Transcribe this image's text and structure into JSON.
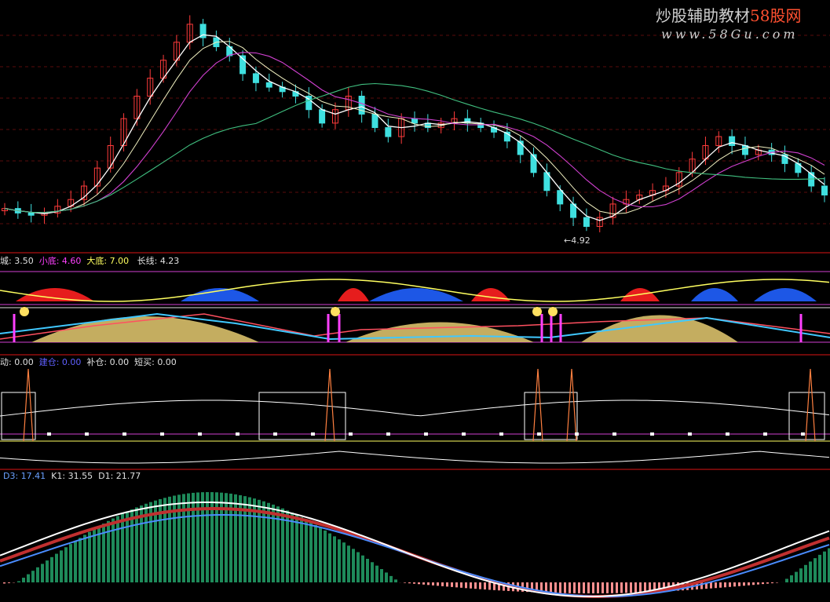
{
  "watermark": {
    "line1_a": "炒股辅助教材",
    "line1_b": "58股网",
    "line2": "www.58Gu.com"
  },
  "price_panel": {
    "low_annotation": "←4.92"
  },
  "indicator1": {
    "labels": [
      {
        "key": "城",
        "value": "3.50",
        "color": "#e0e0e0"
      },
      {
        "key": "小底",
        "value": "4.60",
        "color": "#ff40ff"
      },
      {
        "key": "大底",
        "value": "7.00",
        "color": "#ffff60"
      },
      {
        "key": "长线",
        "value": "4.23",
        "color": "#e0e0e0"
      }
    ]
  },
  "indicator2": {
    "labels": [
      {
        "key": "动",
        "value": "0.00",
        "color": "#e0e0e0"
      },
      {
        "key": "建仓",
        "value": "0.00",
        "color": "#6060ff"
      },
      {
        "key": "补仓",
        "value": "0.00",
        "color": "#e0e0e0"
      },
      {
        "key": "短买",
        "value": "0.00",
        "color": "#e0e0e0"
      }
    ]
  },
  "indicator3": {
    "labels": [
      {
        "key": "D3",
        "value": "17.41",
        "color": "#6aa0ff"
      },
      {
        "key": "K1",
        "value": "31.55",
        "color": "#e0e0e0"
      },
      {
        "key": "D1",
        "value": "21.77",
        "color": "#e0e0e0"
      }
    ]
  },
  "colors": {
    "up": "#ff3b3b",
    "down": "#3fe0e0",
    "grid": "#8b1a1a",
    "ma5": "#ffffff",
    "ma10": "#ffff40",
    "ma20": "#d040d0",
    "ma60": "#40c080"
  },
  "chart_data": {
    "type": "line",
    "title": "",
    "xlabel": "",
    "ylabel": "",
    "ylim": [
      4.8,
      9.9
    ],
    "series": [
      {
        "name": "close",
        "values": [
          5.4,
          5.3,
          5.25,
          5.3,
          5.45,
          5.6,
          5.9,
          6.3,
          6.8,
          7.4,
          7.9,
          8.3,
          8.7,
          9.1,
          9.5,
          9.2,
          9.0,
          8.8,
          8.4,
          8.2,
          8.1,
          8.0,
          7.9,
          7.6,
          7.3,
          7.6,
          7.9,
          7.5,
          7.2,
          7.0,
          7.4,
          7.3,
          7.2,
          7.3,
          7.4,
          7.3,
          7.2,
          7.1,
          6.9,
          6.6,
          6.2,
          5.8,
          5.5,
          5.2,
          5.0,
          5.2,
          5.5,
          5.6,
          5.7,
          5.8,
          5.9,
          6.2,
          6.5,
          6.8,
          7.0,
          6.8,
          6.6,
          6.7,
          6.6,
          6.4,
          6.2,
          5.9,
          5.7
        ]
      }
    ]
  }
}
